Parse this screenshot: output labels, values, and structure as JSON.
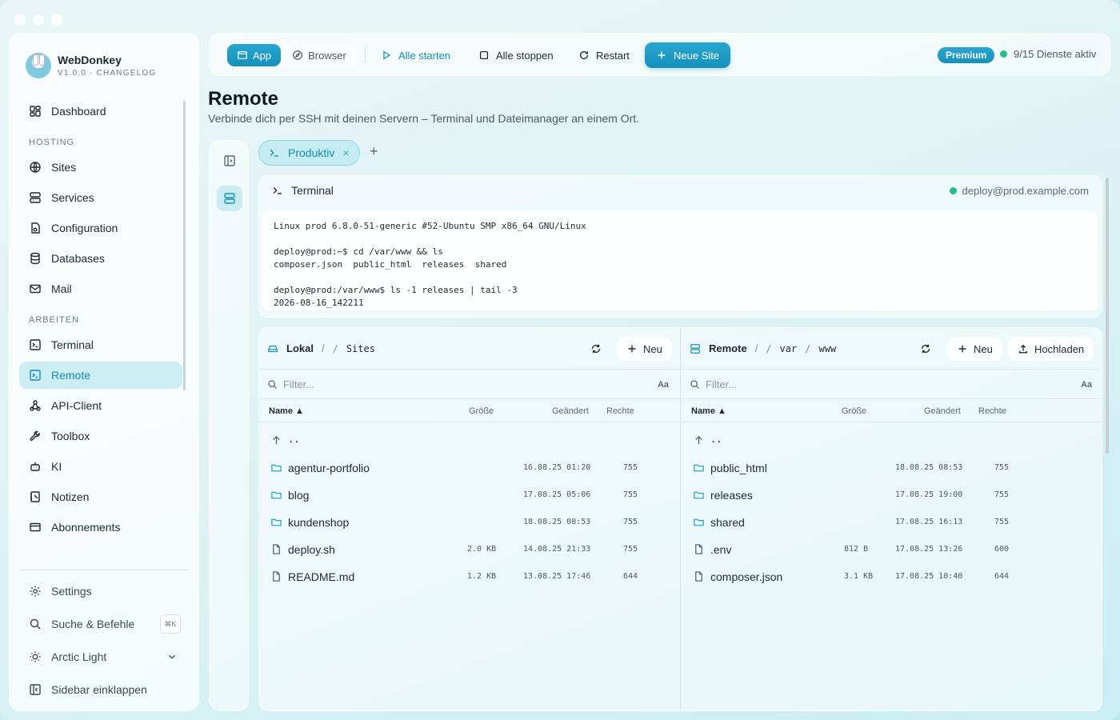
{
  "app": {
    "name": "WebDonkey",
    "version": "V1.0.0 · CHANGELOG"
  },
  "sidebar": {
    "items_top": [
      {
        "label": "Dashboard",
        "icon": "dashboard-icon"
      }
    ],
    "section_hosting": "HOSTING",
    "items_hosting": [
      {
        "label": "Sites",
        "icon": "globe-icon"
      },
      {
        "label": "Services",
        "icon": "server-icon"
      },
      {
        "label": "Configuration",
        "icon": "file-gear-icon"
      },
      {
        "label": "Databases",
        "icon": "database-icon"
      },
      {
        "label": "Mail",
        "icon": "mail-icon"
      }
    ],
    "section_arbeiten": "ARBEITEN",
    "items_arbeiten": [
      {
        "label": "Terminal",
        "icon": "terminal-icon"
      },
      {
        "label": "Remote",
        "icon": "remote-terminal-icon",
        "active": true
      },
      {
        "label": "API-Client",
        "icon": "webhook-icon"
      },
      {
        "label": "Toolbox",
        "icon": "wrench-icon"
      },
      {
        "label": "KI",
        "icon": "bot-icon"
      },
      {
        "label": "Notizen",
        "icon": "notebook-icon"
      },
      {
        "label": "Abonnements",
        "icon": "credit-card-icon"
      }
    ],
    "bottom": {
      "settings": "Settings",
      "search": "Suche & Befehle",
      "search_shortcut": "⌘K",
      "theme": "Arctic Light",
      "collapse": "Sidebar einklappen"
    }
  },
  "topbar": {
    "mode_app": "App",
    "mode_browser": "Browser",
    "start_all": "Alle starten",
    "stop_all": "Alle stoppen",
    "restart": "Restart",
    "new_site": "Neue Site",
    "premium": "Premium",
    "status": "9/15 Dienste aktiv"
  },
  "page": {
    "title": "Remote",
    "subtitle": "Verbinde dich per SSH mit deinen Servern – Terminal und Dateimanager an einem Ort."
  },
  "tabs": [
    {
      "label": "Produktiv",
      "close": "×"
    }
  ],
  "tab_add": "+",
  "terminal": {
    "title": "Terminal",
    "host": "deploy@prod.example.com",
    "output": "Linux prod 6.8.0-51-generic #52-Ubuntu SMP x86_64 GNU/Linux\n\ndeploy@prod:~$ cd /var/www && ls\ncomposer.json  public_html  releases  shared\n\ndeploy@prod:/var/www$ ls -1 releases | tail -3\n2026-08-16_142211"
  },
  "local": {
    "label": "Lokal",
    "sep": "/",
    "path": [
      "/",
      "Sites"
    ],
    "new_button": "Neu",
    "filter_placeholder": "Filter...",
    "case_toggle": "Aa",
    "columns": {
      "name": "Name ▲",
      "size": "Größe",
      "modified": "Geändert",
      "perms": "Rechte"
    },
    "up": "..",
    "rows": [
      {
        "name": "agentur-portfolio",
        "type": "folder",
        "size": "",
        "modified": "16.08.25 01:20",
        "perms": "755"
      },
      {
        "name": "blog",
        "type": "folder",
        "size": "",
        "modified": "17.08.25 05:06",
        "perms": "755"
      },
      {
        "name": "kundenshop",
        "type": "folder",
        "size": "",
        "modified": "18.08.25 08:53",
        "perms": "755"
      },
      {
        "name": "deploy.sh",
        "type": "file",
        "size": "2.0 KB",
        "modified": "14.08.25 21:33",
        "perms": "755"
      },
      {
        "name": "README.md",
        "type": "file",
        "size": "1.2 KB",
        "modified": "13.08.25 17:46",
        "perms": "644"
      }
    ]
  },
  "remote": {
    "label": "Remote",
    "sep": "/",
    "path": [
      "/",
      "var",
      "/",
      "www"
    ],
    "new_button": "Neu",
    "upload_button": "Hochladen",
    "filter_placeholder": "Filter...",
    "case_toggle": "Aa",
    "columns": {
      "name": "Name ▲",
      "size": "Größe",
      "modified": "Geändert",
      "perms": "Rechte"
    },
    "up": "..",
    "rows": [
      {
        "name": "public_html",
        "type": "folder",
        "size": "",
        "modified": "18.08.25 08:53",
        "perms": "755"
      },
      {
        "name": "releases",
        "type": "folder",
        "size": "",
        "modified": "17.08.25 19:00",
        "perms": "755"
      },
      {
        "name": "shared",
        "type": "folder",
        "size": "",
        "modified": "17.08.25 16:13",
        "perms": "755"
      },
      {
        "name": ".env",
        "type": "file",
        "size": "812 B",
        "modified": "17.08.25 13:26",
        "perms": "600"
      },
      {
        "name": "composer.json",
        "type": "file",
        "size": "3.1 KB",
        "modified": "17.08.25 10:40",
        "perms": "644"
      }
    ]
  },
  "colors": {
    "accent": "#1591bb",
    "status_ok": "#22c08a"
  }
}
